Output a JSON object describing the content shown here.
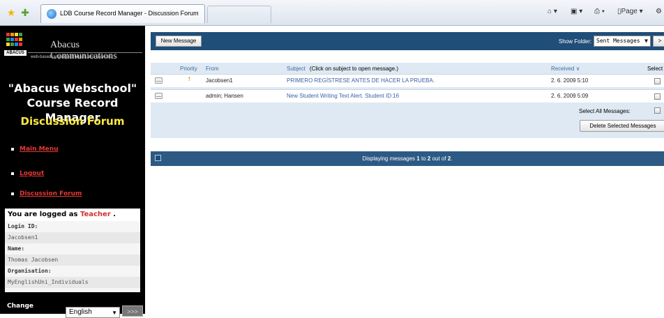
{
  "browser": {
    "tab_title": "LDB Course Record Manager - Discussion Forum",
    "page_menu": "Page ▾",
    "favorites_icon": "star-icon",
    "add_favorites_icon": "add-favorite-icon"
  },
  "sidebar": {
    "brand": "Abacus Communications",
    "logo_word": "ABACUS",
    "tagline": "web-based language products and services",
    "app_title_1": "\"Abacus Webschool\"",
    "app_title_2": "Course Record Manager",
    "forum_title": "Discussion Forum",
    "nav": [
      {
        "label": "Main Menu"
      },
      {
        "label": "Logout"
      },
      {
        "label": "Discussion Forum"
      }
    ],
    "login": {
      "prefix": "You are logged as",
      "role": "Teacher",
      "suffix": ".",
      "login_id_label": "Login ID:",
      "login_id": "Jacobsen1",
      "name_label": "Name:",
      "name": "Thomas Jacobsen",
      "org_label": "Organisation:",
      "org": "MyEnglishUni_Individuals"
    },
    "change_label": "Change",
    "language": "English",
    "go_label": ">>>"
  },
  "toolbar": {
    "new_message_label": "New Message",
    "show_folder_label": "Show Folder:",
    "folder_value": "Sent Messages",
    "folder_go_label": ">"
  },
  "messages": {
    "headers": {
      "priority": "Priority",
      "from": "From",
      "subject": "Subject",
      "subject_hint": "(Click on subject to open message.)",
      "received": "Received ∨",
      "select": "Select"
    },
    "rows": [
      {
        "priority": "!",
        "from": "Jacobsen1",
        "subject": "PRIMERO REGÍSTRESE ANTES DE HACER LA PRUEBA.",
        "received": "2. 6. 2009 5:10"
      },
      {
        "priority": "",
        "from": "admin; Hansen",
        "subject": "New Student Writing Text Alert. Student ID:16",
        "received": "2. 6. 2009 5:09"
      }
    ],
    "select_all_label": "Select All Messages:",
    "delete_label": "Delete Selected Messages"
  },
  "footer": {
    "prefix": "Displaying messages",
    "from": "1",
    "to_word": "to",
    "to": "2",
    "out_of_word": "out of",
    "total": "2",
    "suffix": "."
  }
}
